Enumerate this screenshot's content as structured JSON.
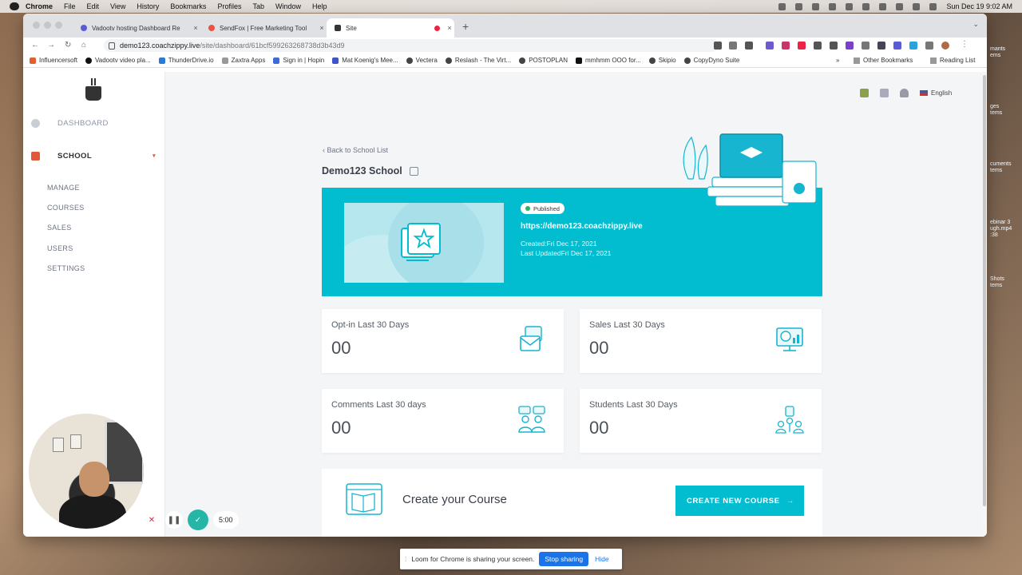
{
  "os_menubar": {
    "app": "Chrome",
    "items": [
      "File",
      "Edit",
      "View",
      "History",
      "Bookmarks",
      "Profiles",
      "Tab",
      "Window",
      "Help"
    ],
    "clock": "Sun Dec 19  9:02 AM"
  },
  "desktop": {
    "labels": [
      "mants",
      "ems",
      "ges",
      "tems",
      "cuments",
      "tems",
      "ebinar 3",
      "ugh.mp4",
      ":38",
      "Shots",
      "tems"
    ]
  },
  "browser": {
    "tabs": [
      {
        "title": "Vadootv hosting Dashboard Re",
        "active": false
      },
      {
        "title": "SendFox | Free Marketing Tool",
        "active": false
      },
      {
        "title": "Site",
        "active": true
      }
    ],
    "url_host": "demo123.coachzippy.live",
    "url_path": "/site/dashboard/61bcf599263268738d3b43d9",
    "bookmarks": [
      "Influencersoft",
      "Vadootv video pla...",
      "ThunderDrive.io",
      "Zaxtra Apps",
      "Sign in | Hopin",
      "Mat Koenig's Mee...",
      "Vectera",
      "Reslash - The Virt...",
      "POSTOPLAN",
      "mmhmm OOO for...",
      "Skipio",
      "CopyDyno Suite"
    ],
    "bookmarks_more": "»",
    "other_bookmarks": "Other Bookmarks",
    "reading_list": "Reading List"
  },
  "sidebar": {
    "dashboard": "DASHBOARD",
    "school": "SCHOOL",
    "caret": "▾",
    "submenu": [
      "MANAGE",
      "COURSES",
      "SALES",
      "USERS",
      "SETTINGS"
    ]
  },
  "topbar": {
    "language": "English"
  },
  "main": {
    "back_link": "Back to School List",
    "school_title": "Demo123 School",
    "banner": {
      "status": "Published",
      "site_url": "https://demo123.coachzippy.live",
      "created": "Created:Fri Dec 17, 2021",
      "updated": "Last UpdatedFri Dec 17, 2021"
    },
    "stats": [
      {
        "label": "Opt-in Last 30 Days",
        "value": "00",
        "icon": "envelope-icon"
      },
      {
        "label": "Sales Last 30 Days",
        "value": "00",
        "icon": "monitor-dollar-icon"
      },
      {
        "label": "Comments Last 30 days",
        "value": "00",
        "icon": "chat-people-icon"
      },
      {
        "label": "Students Last 30 Days",
        "value": "00",
        "icon": "students-icon"
      }
    ],
    "create_course": {
      "text": "Create your Course",
      "button": "CREATE NEW COURSE",
      "arrow": "→"
    }
  },
  "recorder": {
    "timer": "5:00",
    "more": "···"
  },
  "loom_bar": {
    "message": "Loom for Chrome is sharing your screen.",
    "stop": "Stop sharing",
    "hide": "Hide"
  },
  "colors": {
    "accent": "#02bccf",
    "school_red": "#e05a3a"
  }
}
